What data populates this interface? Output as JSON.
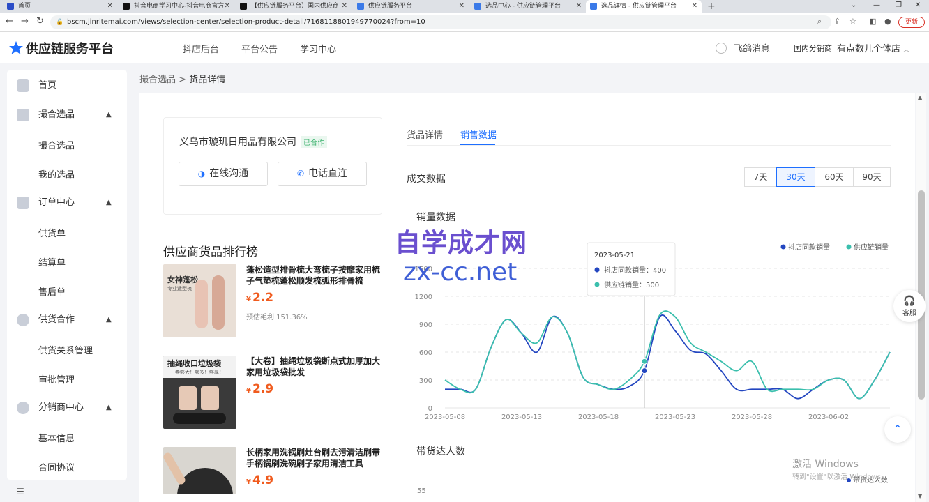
{
  "browser": {
    "tabs": [
      {
        "label": "首页",
        "icon_color": "#2a4cc7"
      },
      {
        "label": "抖音电商学习中心-抖音电商官方",
        "icon_color": "#111111"
      },
      {
        "label": "【供应链服务平台】国内供应商",
        "icon_color": "#111111"
      },
      {
        "label": "供应链服务平台",
        "icon_color": "#3b7ae8"
      },
      {
        "label": "选品中心 - 供应链管理平台",
        "icon_color": "#3b7ae8"
      },
      {
        "label": "选品详情 - 供应链管理平台",
        "icon_color": "#3b7ae8"
      }
    ],
    "url": "bscm.jinritemai.com/views/selection-center/selection-product-detail/7168118801949770024?from=10",
    "update_label": "更新"
  },
  "header": {
    "logo_text": "供应链服务平台",
    "nav": [
      "抖店后台",
      "平台公告",
      "学习中心"
    ],
    "message_label": "飞鸽消息",
    "dist_label": "国内分销商",
    "account_label": "有点数儿个体店"
  },
  "sidebar": {
    "items": [
      {
        "label": "首页",
        "type": "top"
      },
      {
        "label": "撮合选品",
        "type": "group"
      },
      {
        "label": "撮合选品",
        "type": "sub"
      },
      {
        "label": "我的选品",
        "type": "sub"
      },
      {
        "label": "订单中心",
        "type": "group"
      },
      {
        "label": "供货单",
        "type": "sub"
      },
      {
        "label": "结算单",
        "type": "sub"
      },
      {
        "label": "售后单",
        "type": "sub"
      },
      {
        "label": "供货合作",
        "type": "group"
      },
      {
        "label": "供货关系管理",
        "type": "sub"
      },
      {
        "label": "审批管理",
        "type": "sub"
      },
      {
        "label": "分销商中心",
        "type": "group"
      },
      {
        "label": "基本信息",
        "type": "sub"
      },
      {
        "label": "合同协议",
        "type": "sub"
      }
    ]
  },
  "breadcrumb": {
    "parent": "撮合选品",
    "sep": ">",
    "current": "货品详情"
  },
  "supplier": {
    "name": "义乌市璇玑日用品有限公司",
    "badge": "已合作",
    "chat_label": "在线沟通",
    "phone_label": "电话直连"
  },
  "ranking": {
    "title": "供应商货品排行榜",
    "products": [
      {
        "title": "蓬松造型排骨梳大弯梳子按摩家用梳子气垫梳蓬松顺发梳弧形排骨梳",
        "currency": "¥",
        "price": "2.2",
        "margin": "预估毛利 151.36%",
        "img_text": "女神蓬松",
        "img_sub": "专业造型梳",
        "img_bg": "#e9dfd6"
      },
      {
        "title": "【大卷】抽绳垃圾袋断点式加厚加大家用垃圾袋批发",
        "currency": "¥",
        "price": "2.9",
        "margin": "",
        "img_text": "抽绳收口垃圾袋",
        "img_sub": "一卷够大！够多！够厚！",
        "img_bg": "#3a3a3a"
      },
      {
        "title": "长柄家用洗锅刷灶台刷去污清洁刷带手柄锅刷洗碗刷子家用清洁工具",
        "currency": "¥",
        "price": "4.9",
        "margin": "",
        "img_text": "",
        "img_sub": "",
        "img_bg": "#d9d6d0"
      }
    ]
  },
  "detail_tabs": {
    "items": [
      "货品详情",
      "销售数据"
    ],
    "active": "销售数据"
  },
  "deal": {
    "title": "成交数据",
    "ranges": [
      "7天",
      "30天",
      "60天",
      "90天"
    ],
    "active_range": "30天"
  },
  "sales_chart": {
    "subtitle": "销量数据"
  },
  "chart_data": {
    "type": "line",
    "ylim": [
      0,
      1500
    ],
    "y_ticks": [
      0,
      300,
      600,
      900,
      1200,
      1500
    ],
    "x_tick_labels": [
      "2023-05-08",
      "2023-05-13",
      "2023-05-18",
      "2023-05-23",
      "2023-05-28",
      "2023-06-02"
    ],
    "x": [
      "2023-05-08",
      "2023-05-09",
      "2023-05-10",
      "2023-05-11",
      "2023-05-12",
      "2023-05-13",
      "2023-05-14",
      "2023-05-15",
      "2023-05-16",
      "2023-05-17",
      "2023-05-18",
      "2023-05-19",
      "2023-05-20",
      "2023-05-21",
      "2023-05-22",
      "2023-05-23",
      "2023-05-24",
      "2023-05-25",
      "2023-05-26",
      "2023-05-27",
      "2023-05-28",
      "2023-05-29",
      "2023-05-30",
      "2023-05-31",
      "2023-06-01",
      "2023-06-02",
      "2023-06-03",
      "2023-06-04",
      "2023-06-05",
      "2023-06-06"
    ],
    "legend_position": "top-right",
    "grid": true,
    "series": [
      {
        "name": "抖店同款销量",
        "color": "#2346c0",
        "values": [
          200,
          200,
          200,
          650,
          950,
          800,
          600,
          980,
          800,
          330,
          250,
          200,
          230,
          400,
          980,
          830,
          620,
          580,
          400,
          200,
          200,
          200,
          200,
          100,
          200,
          300,
          300,
          100,
          300,
          600
        ]
      },
      {
        "name": "供应链销量",
        "color": "#3bbfad",
        "values": [
          300,
          200,
          200,
          650,
          950,
          800,
          700,
          980,
          800,
          330,
          250,
          200,
          300,
          500,
          1000,
          980,
          700,
          600,
          500,
          400,
          500,
          200,
          200,
          200,
          200,
          300,
          300,
          100,
          300,
          600
        ]
      }
    ],
    "tooltip": {
      "date": "2023-05-21",
      "rows": [
        {
          "name": "抖店同款销量",
          "value": "400"
        },
        {
          "name": "供应链销量",
          "value": "500"
        }
      ]
    }
  },
  "talent": {
    "title": "带货达人数",
    "legend": "带货达人数",
    "y_top": "55"
  },
  "service_label": "客服",
  "watermark": {
    "cn": "自学成才网",
    "en": "zx-cc.net"
  },
  "windows": {
    "title": "激活 Windows",
    "sub": "转到\"设置\"以激活 Windows。"
  }
}
